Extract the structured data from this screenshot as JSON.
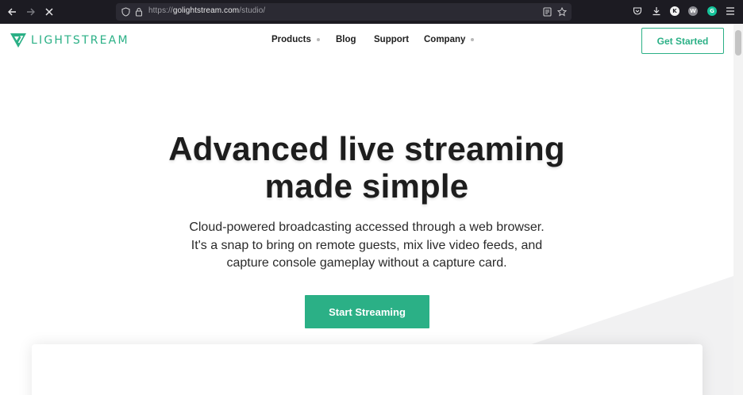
{
  "browser": {
    "url_scheme": "https://",
    "url_host": "golightstream.com",
    "url_path": "/studio/",
    "ext_k": "K",
    "ext_w": "W",
    "ext_g": "G"
  },
  "site": {
    "brand": "LIGHTSTREAM",
    "brand_color": "#2bb086",
    "nav": {
      "products": "Products",
      "blog": "Blog",
      "support": "Support",
      "company": "Company"
    },
    "get_started": "Get Started"
  },
  "hero": {
    "title_line1": "Advanced live streaming",
    "title_line2": "made simple",
    "sub_line1": "Cloud-powered broadcasting accessed through a web browser.",
    "sub_line2": "It's a snap to bring on remote guests, mix live video feeds, and",
    "sub_line3": "capture console gameplay without a capture card.",
    "cta": "Start Streaming"
  }
}
